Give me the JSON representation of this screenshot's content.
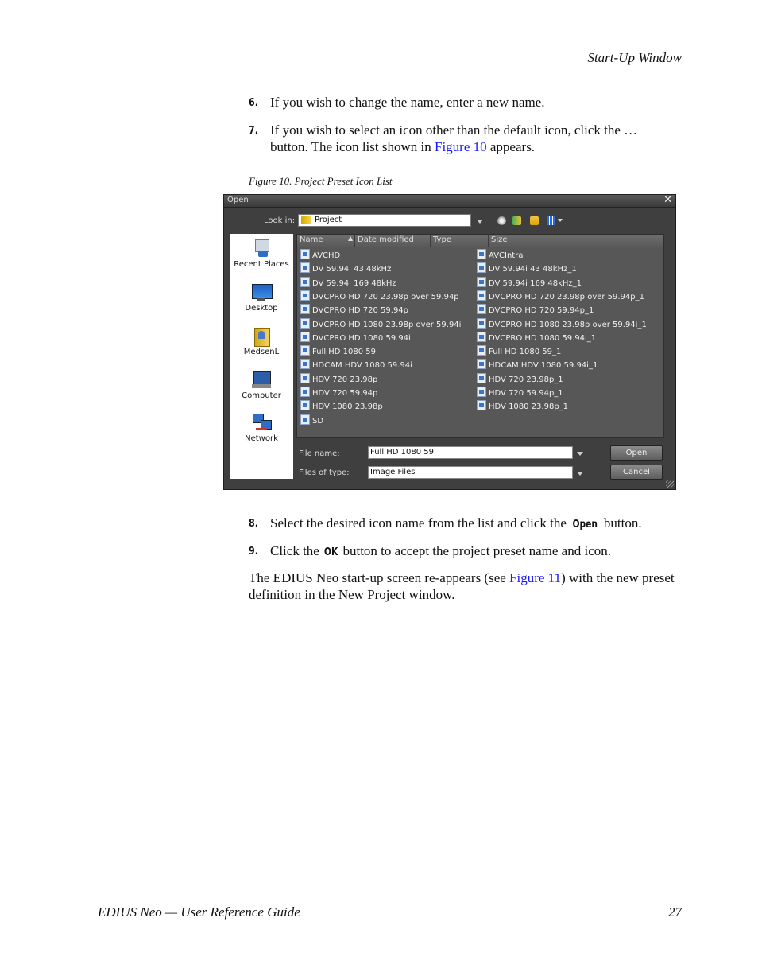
{
  "header": {
    "running_title": "Start-Up Window"
  },
  "steps": [
    {
      "num": "6.",
      "text": "If you wish to change the name, enter a new name."
    },
    {
      "num": "7.",
      "text_before": "If you wish to select an icon other than the default icon, click the …",
      "text_line2_before": "button. The icon list shown in ",
      "link": "Figure 10",
      "text_after": " appears."
    },
    {
      "num": "8.",
      "text_before": "Select the desired icon name from the list and click the ",
      "ui": "Open",
      "text_after": " button."
    },
    {
      "num": "9.",
      "text_before": "Click the ",
      "ui": "OK",
      "text_after": " button to accept the project preset name and icon."
    }
  ],
  "figure_caption": "Figure 10.  Project Preset Icon List",
  "paragraph": {
    "before": "The EDIUS Neo start-up screen re-appears (see ",
    "link": "Figure 11",
    "after": ") with the new preset definition in the New Project window."
  },
  "dialog": {
    "title": "Open",
    "close": "✕",
    "look_in_label": "Look in:",
    "look_in_value": "Project",
    "places": [
      "Recent Places",
      "Desktop",
      "MedsenL",
      "Computer",
      "Network"
    ],
    "columns": [
      "Name",
      "Date modified",
      "Type",
      "Size"
    ],
    "files_left": [
      "AVCHD",
      "DV 59.94i 43 48kHz",
      "DV 59.94i 169 48kHz",
      "DVCPRO HD 720 23.98p over 59.94p",
      "DVCPRO HD 720 59.94p",
      "DVCPRO HD 1080 23.98p over 59.94i",
      "DVCPRO HD 1080 59.94i",
      "Full HD 1080 59",
      "HDCAM HDV 1080 59.94i",
      "HDV 720 23.98p",
      "HDV 720 59.94p",
      "HDV 1080 23.98p",
      "SD"
    ],
    "files_right": [
      "AVCIntra",
      "DV 59.94i 43 48kHz_1",
      "DV 59.94i 169 48kHz_1",
      "DVCPRO HD 720 23.98p over 59.94p_1",
      "DVCPRO HD 720 59.94p_1",
      "DVCPRO HD 1080 23.98p over 59.94i_1",
      "DVCPRO HD 1080 59.94i_1",
      "Full HD 1080 59_1",
      "HDCAM HDV 1080 59.94i_1",
      "HDV 720 23.98p_1",
      "HDV 720 59.94p_1",
      "HDV 1080 23.98p_1"
    ],
    "file_name_label": "File name:",
    "file_name_value": "Full HD 1080 59",
    "files_type_label": "Files of type:",
    "files_type_value": "Image Files",
    "open_button": "Open",
    "cancel_button": "Cancel"
  },
  "footer": {
    "left": "EDIUS Neo  —  User Reference Guide",
    "page": "27"
  }
}
